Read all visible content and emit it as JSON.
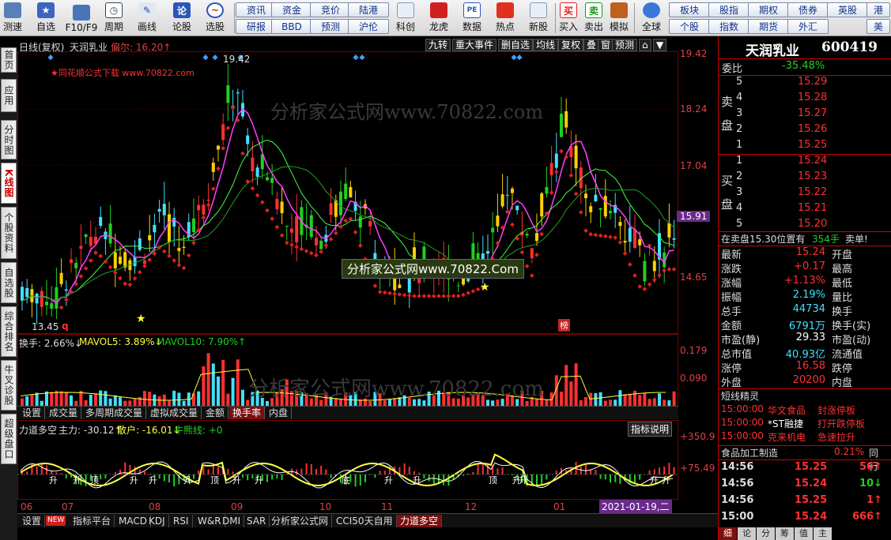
{
  "toolbar": {
    "left_buttons": [
      {
        "label": "测速",
        "icon": "speed-icon"
      },
      {
        "label": "自选",
        "icon": "star-icon"
      },
      {
        "label": "F10/F9",
        "icon": "f10-icon"
      },
      {
        "label": "周期",
        "icon": "clock-icon"
      },
      {
        "label": "画线",
        "icon": "pencil-icon"
      },
      {
        "label": "论股",
        "icon": "discuss-icon"
      },
      {
        "label": "选股",
        "icon": "select-stock-icon"
      }
    ],
    "grid_top": [
      "资讯",
      "资金",
      "竞价",
      "陆港"
    ],
    "grid_bottom": [
      "研报",
      "BBD",
      "预测",
      "沪伦"
    ],
    "mid_buttons": [
      {
        "label": "科创",
        "icon": "kechuang-icon"
      },
      {
        "label": "龙虎",
        "icon": "dragon-tiger-icon"
      },
      {
        "label": "数据",
        "icon": "data-icon"
      },
      {
        "label": "热点",
        "icon": "hotspot-icon"
      },
      {
        "label": "新股",
        "icon": "new-stock-icon"
      },
      {
        "label": "买入",
        "icon": "buy-icon"
      },
      {
        "label": "卖出",
        "icon": "sell-icon"
      },
      {
        "label": "模拟",
        "icon": "simulate-icon"
      },
      {
        "label": "全球",
        "icon": "globe-icon"
      }
    ],
    "buy_glyph": "买",
    "sell_glyph": "卖",
    "pe_glyph": "PE",
    "right_top": [
      "板块",
      "股指",
      "期权",
      "债券",
      "英股",
      "港"
    ],
    "right_bottom": [
      "个股",
      "指数",
      "期货",
      "外汇",
      "美"
    ]
  },
  "left_tabs": [
    "首页",
    "应用",
    "分时图",
    "K线图",
    "个股资料",
    "自选股",
    "综合排名",
    "牛叉诊股",
    "超级盘口"
  ],
  "chart": {
    "title_line": "日线(复权)",
    "stock_name": "天润乳业",
    "extra": "偏尔: 16.20↑",
    "watermark_note": "★同花顺公式下载 www.70822.com",
    "watermark_big": "分析家公式网www.70822.com",
    "watermark_box": "分析家公式网www.70822.Com",
    "high_label": "19.42",
    "low_label": "13.45",
    "q_label": "q",
    "bang_label": "榜",
    "top_tabs": [
      "九转",
      "重大事件",
      "删自选",
      "均线",
      "复权",
      "叠",
      "窗",
      "预测"
    ],
    "price_axis": [
      "19.42",
      "18.24",
      "17.04",
      "15.91",
      "14.65"
    ],
    "current_price_tag": "15.91",
    "volume_header": [
      {
        "text": "换手: 2.66%↓",
        "color": "#ffffff"
      },
      {
        "text": "MAVOL5: 3.89%↓",
        "color": "#ffff40"
      },
      {
        "text": "MAVOL10: 7.90%↑",
        "color": "#20d020"
      }
    ],
    "volume_axis": [
      "0.179",
      "0.090"
    ],
    "volume_tabs": [
      "设置",
      "成交量",
      "多周期成交量",
      "虚拟成交量",
      "金额",
      "换手率",
      "内盘"
    ],
    "volume_active_tab": "换手率",
    "ind_header": [
      {
        "text": "力道多空",
        "color": "#ffffff"
      },
      {
        "text": "主力: -30.12↑",
        "color": "#ffffff"
      },
      {
        "text": "散户: -16.01↓",
        "color": "#ffff40"
      },
      {
        "text": "牛熊线: +0",
        "color": "#20d020"
      }
    ],
    "ind_explain_btn": "指标说明",
    "ind_axis": [
      "+350.9",
      "+75.49"
    ],
    "ind_marks": [
      "升",
      "升",
      "顶",
      "升",
      "升",
      "升",
      "顶",
      "升",
      "升",
      "底",
      "升",
      "升",
      "顶",
      "升",
      "升",
      "升",
      "升"
    ],
    "date_axis": [
      "06",
      "07",
      "08",
      "09",
      "10",
      "11",
      "12",
      "01"
    ],
    "date_cursor": "2021-01-19,二"
  },
  "bottom_tabs": [
    "设置",
    "指标平台",
    "MACD",
    "KDJ",
    "RSI",
    "W&R",
    "DMI",
    "SAR",
    "分析家公式网",
    "CCI50天自用",
    "力道多空"
  ],
  "new_badge": "NEW",
  "bottom_active_tab": "力道多空",
  "quote": {
    "name": "天润乳业",
    "code": "600419",
    "weibi_label": "委比",
    "weibi_value": "-35.48%",
    "sell_side_label": "卖盘",
    "sell_levels": [
      {
        "level": "5",
        "price": "15.29"
      },
      {
        "level": "4",
        "price": "15.28"
      },
      {
        "level": "3",
        "price": "15.27"
      },
      {
        "level": "2",
        "price": "15.26"
      },
      {
        "level": "1",
        "price": "15.25"
      }
    ],
    "buy_side_label": "买盘",
    "buy_levels": [
      {
        "level": "1",
        "price": "15.24"
      },
      {
        "level": "2",
        "price": "15.23"
      },
      {
        "level": "3",
        "price": "15.22"
      },
      {
        "level": "4",
        "price": "15.21"
      },
      {
        "level": "5",
        "price": "15.20"
      }
    ],
    "status_line_a": "在卖盘15.30位置有",
    "status_line_b": "354手",
    "status_line_c": "卖单!",
    "stats": [
      {
        "label": "最新",
        "value": "15.24",
        "color": "red",
        "label2": "开盘"
      },
      {
        "label": "涨跌",
        "value": "+0.17",
        "color": "red",
        "label2": "最高"
      },
      {
        "label": "涨幅",
        "value": "+1.13%",
        "color": "red",
        "label2": "最低"
      },
      {
        "label": "振幅",
        "value": "2.19%",
        "color": "cyan",
        "label2": "量比"
      },
      {
        "label": "总手",
        "value": "44734",
        "color": "cyan",
        "label2": "换手"
      },
      {
        "label": "金额",
        "value": "6791万",
        "color": "cyan",
        "label2": "换手(实)"
      },
      {
        "label": "市盈(静)",
        "value": "29.33",
        "color": "white",
        "label2": "市盈(动)"
      },
      {
        "label": "总市值",
        "value": "40.93亿",
        "color": "cyan",
        "label2": "流通值"
      },
      {
        "label": "涨停",
        "value": "16.58",
        "color": "red",
        "label2": "跌停"
      },
      {
        "label": "外盘",
        "value": "20200",
        "color": "red",
        "label2": "内盘"
      }
    ],
    "news_title": "短线精灵",
    "news": [
      {
        "time": "15:00:00",
        "name": "华文食品",
        "event": "封涨停板"
      },
      {
        "time": "15:00:00",
        "name": "*ST融捷",
        "event": "打开跌停板"
      },
      {
        "time": "15:00:00",
        "name": "克来机电",
        "event": "急速拉升"
      }
    ],
    "sector_name": "食品加工制造",
    "sector_change": "0.21%",
    "sector_tail": "同行",
    "ticks": [
      {
        "time": "14:56",
        "price": "15.25",
        "vol": "56",
        "dir": "up"
      },
      {
        "time": "14:56",
        "price": "15.24",
        "vol": "10",
        "dir": "down"
      },
      {
        "time": "14:56",
        "price": "15.25",
        "vol": "1",
        "dir": "up"
      },
      {
        "time": "15:00",
        "price": "15.24",
        "vol": "666",
        "dir": "up"
      }
    ],
    "bottom_tabs": [
      "细",
      "论",
      "分",
      "筹",
      "值",
      "主"
    ]
  },
  "colors": {
    "up": "#ff3030",
    "down": "#20d020",
    "cyan": "#40e0ff",
    "yellow": "#ffff40",
    "magenta": "#ff40ff",
    "grid": "#7a0000"
  }
}
